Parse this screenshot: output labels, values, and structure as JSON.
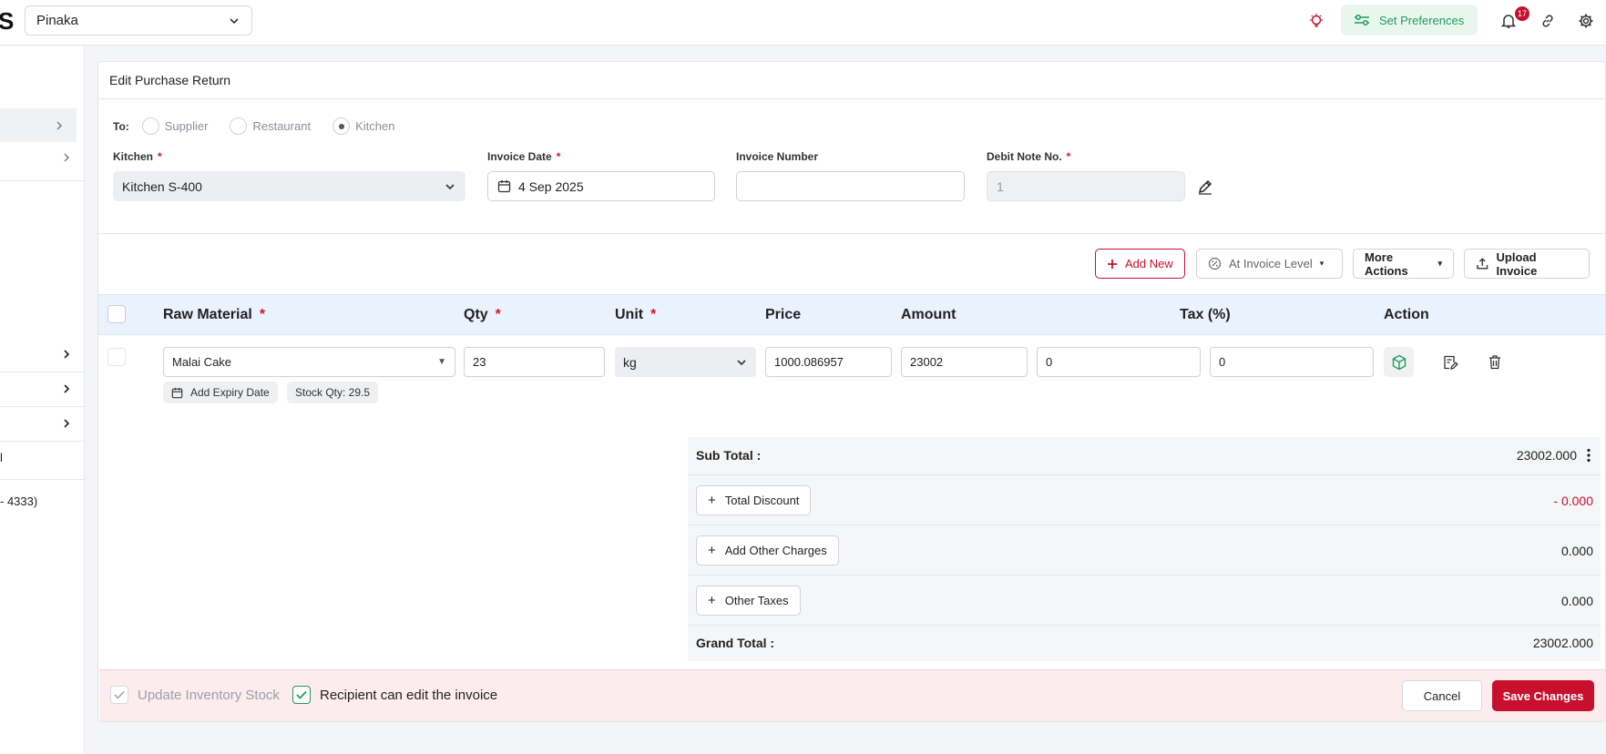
{
  "topbar": {
    "brand_letter": "S",
    "outlet": "Pinaka",
    "set_preferences": "Set Preferences",
    "notification_count": "17"
  },
  "sidebar": {
    "fragment_a": "l",
    "fragment_b": "- 4333)"
  },
  "form": {
    "title": "Edit Purchase Return",
    "to_label": "To:",
    "to_options": [
      "Supplier",
      "Restaurant",
      "Kitchen"
    ],
    "to_selected": "Kitchen",
    "kitchen_label": "Kitchen",
    "kitchen_value": "Kitchen S-400",
    "invoice_date_label": "Invoice Date",
    "invoice_date_value": "4 Sep 2025",
    "invoice_number_label": "Invoice Number",
    "invoice_number_value": "",
    "debit_note_label": "Debit Note No.",
    "debit_note_value": "1",
    "required_mark": "*"
  },
  "actions": {
    "add_new": "Add New",
    "invoice_level": "At Invoice Level",
    "more_actions": "More Actions",
    "upload_invoice": "Upload Invoice"
  },
  "table": {
    "headers": {
      "raw_material": "Raw Material",
      "qty": "Qty",
      "unit": "Unit",
      "price": "Price",
      "amount": "Amount",
      "tax": "Tax (%)",
      "action": "Action"
    },
    "row": {
      "raw_material": "Malai Cake",
      "qty": "23",
      "unit": "kg",
      "price": "1000.086957",
      "amount": "23002",
      "extra": "0",
      "tax": "0",
      "add_expiry": "Add Expiry Date",
      "stock_qty": "Stock Qty: 29.5"
    }
  },
  "totals": {
    "sub_total_label": "Sub Total :",
    "sub_total_value": "23002.000",
    "discount_button": "Total Discount",
    "discount_value": "- 0.000",
    "other_charges_button": "Add Other Charges",
    "other_charges_value": "0.000",
    "other_taxes_button": "Other Taxes",
    "other_taxes_value": "0.000",
    "grand_total_label": "Grand Total :",
    "grand_total_value": "23002.000"
  },
  "footer": {
    "update_inventory": "Update Inventory Stock",
    "recipient_edit": "Recipient can edit the invoice",
    "cancel": "Cancel",
    "save": "Save Changes"
  },
  "colors": {
    "accent_red": "#c8102e",
    "accent_green": "#1f9d5a",
    "table_header_bg": "#eaf3fd",
    "footer_bg": "#fdecee"
  }
}
